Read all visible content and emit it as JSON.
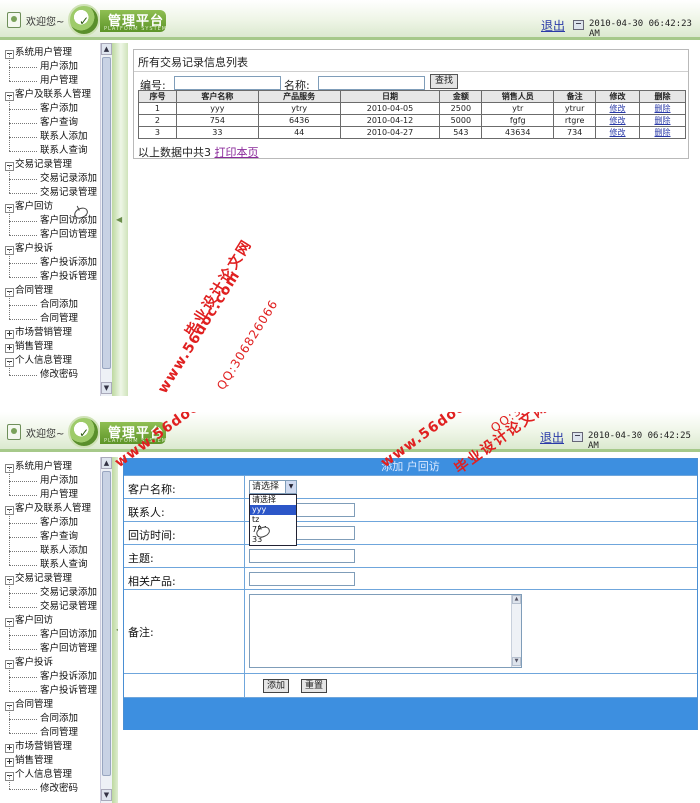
{
  "header": {
    "welcome": "欢迎您~",
    "logo_title": "管理平台",
    "logo_sub": "PLATFORM SYSTEM",
    "logout": "退出"
  },
  "screen1": {
    "datetime": "2010-04-30 06:42:23 AM",
    "sidebar": [
      {
        "label": "系统用户管理",
        "children": [
          "用户添加",
          "用户管理"
        ]
      },
      {
        "label": "客户及联系人管理",
        "children": [
          "客户添加",
          "客户查询",
          "联系人添加",
          "联系人查询"
        ]
      },
      {
        "label": "交易记录管理",
        "children": [
          "交易记录添加",
          "交易记录管理"
        ]
      },
      {
        "label": "客户回访",
        "children": [
          "客户回访添加",
          "客户回访管理"
        ]
      },
      {
        "label": "客户投诉",
        "children": [
          "客户投诉添加",
          "客户投诉管理"
        ]
      },
      {
        "label": "合同管理",
        "children": [
          "合同添加",
          "合同管理"
        ]
      },
      {
        "label": "市场营销管理",
        "children": []
      },
      {
        "label": "销售管理",
        "children": []
      },
      {
        "label": "个人信息管理",
        "children": [
          "修改密码"
        ]
      }
    ],
    "panel_title": "所有交易记录信息列表",
    "search": {
      "number_label": "编号:",
      "name_label": "名称:",
      "button": "查找",
      "number_value": "",
      "name_value": ""
    },
    "table": {
      "headers": [
        "序号",
        "客户名称",
        "产品服务",
        "日期",
        "金额",
        "销售人员",
        "备注",
        "修改",
        "删除"
      ],
      "rows": [
        [
          "1",
          "yyy",
          "ytry",
          "2010-04-05",
          "2500",
          "ytr",
          "ytrur",
          "修改",
          "删除"
        ],
        [
          "2",
          "754",
          "6436",
          "2010-04-12",
          "5000",
          "fgfg",
          "rtgre",
          "修改",
          "删除"
        ],
        [
          "3",
          "33",
          "44",
          "2010-04-27",
          "543",
          "43634",
          "734",
          "修改",
          "删除"
        ]
      ]
    },
    "footer_text": "以上数据中共3",
    "print_link": "打印本页"
  },
  "screen2": {
    "datetime": "2010-04-30 06:42:25 AM",
    "sidebar": [
      {
        "label": "系统用户管理",
        "children": [
          "用户添加",
          "用户管理"
        ]
      },
      {
        "label": "客户及联系人管理",
        "children": [
          "客户添加",
          "客户查询",
          "联系人添加",
          "联系人查询"
        ]
      },
      {
        "label": "交易记录管理",
        "children": [
          "交易记录添加",
          "交易记录管理"
        ]
      },
      {
        "label": "客户回访",
        "children": [
          "客户回访添加",
          "客户回访管理"
        ]
      },
      {
        "label": "客户投诉",
        "children": [
          "客户投诉添加",
          "客户投诉管理"
        ]
      },
      {
        "label": "合同管理",
        "children": [
          "合同添加",
          "合同管理"
        ]
      },
      {
        "label": "市场营销管理",
        "children": []
      },
      {
        "label": "销售管理",
        "children": []
      },
      {
        "label": "个人信息管理",
        "children": [
          "修改密码"
        ]
      }
    ],
    "form_title": "添加客户回访",
    "form_title_visible": "添加  户回访",
    "fields": {
      "customer_label": "客户名称:",
      "contact_label": "联系人:",
      "time_label": "回访时间:",
      "subject_label": "主题:",
      "product_label": "相关产品:",
      "notes_label": "备注:"
    },
    "select_value": "请选择",
    "select_options": [
      "请选择",
      "yyy",
      "tz",
      "754",
      "33"
    ],
    "selected_index": 1,
    "add_button": "添加",
    "reset_button": "重置"
  },
  "watermark": {
    "site": "www.56doc.com",
    "qq": "QQ:306826066",
    "name": "毕业设计论文网"
  }
}
